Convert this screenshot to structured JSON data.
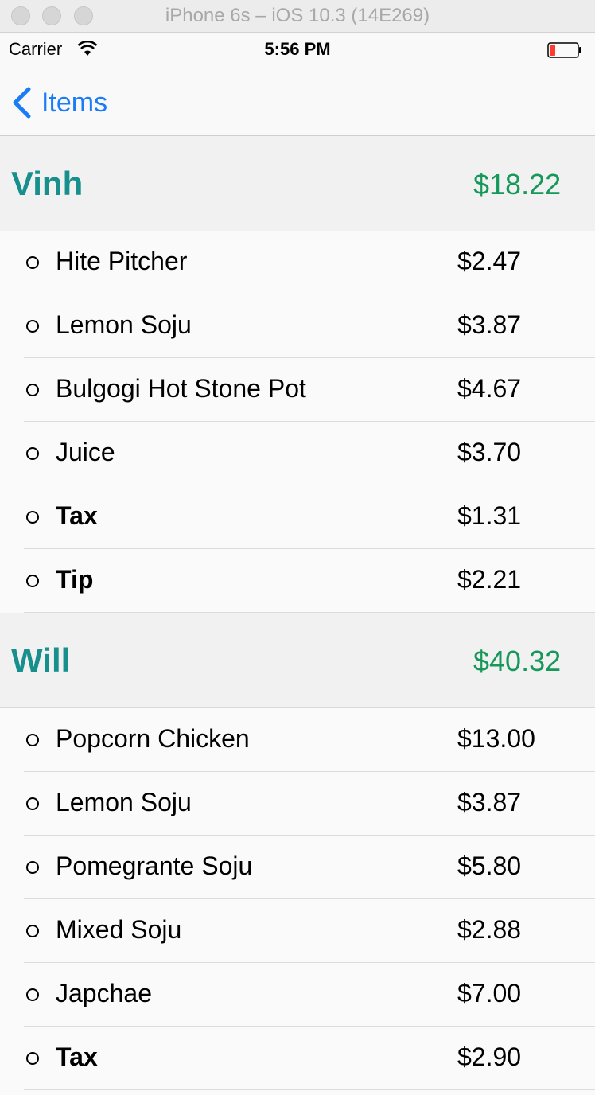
{
  "simulator": {
    "title": "iPhone 6s – iOS 10.3 (14E269)"
  },
  "status_bar": {
    "carrier": "Carrier",
    "time": "5:56 PM",
    "battery_color": "#ff3b30"
  },
  "nav": {
    "back_label": "Items",
    "accent": "#1a7cf6"
  },
  "colors": {
    "section_name": "#178f8c",
    "section_total": "#16985a"
  },
  "sections": [
    {
      "name": "Vinh",
      "total": "$18.22",
      "items": [
        {
          "name": "Hite Pitcher",
          "price": "$2.47"
        },
        {
          "name": "Lemon Soju",
          "price": "$3.87"
        },
        {
          "name": "Bulgogi Hot Stone Pot",
          "price": "$4.67"
        },
        {
          "name": "Juice",
          "price": "$3.70"
        },
        {
          "name": "Tax",
          "price": "$1.31"
        },
        {
          "name": "Tip",
          "price": "$2.21"
        }
      ]
    },
    {
      "name": "Will",
      "total": "$40.32",
      "items": [
        {
          "name": "Popcorn Chicken",
          "price": "$13.00"
        },
        {
          "name": "Lemon Soju",
          "price": "$3.87"
        },
        {
          "name": "Pomegrante Soju",
          "price": "$5.80"
        },
        {
          "name": "Mixed Soju",
          "price": "$2.88"
        },
        {
          "name": "Japchae",
          "price": "$7.00"
        },
        {
          "name": "Tax",
          "price": "$2.90"
        }
      ]
    }
  ]
}
